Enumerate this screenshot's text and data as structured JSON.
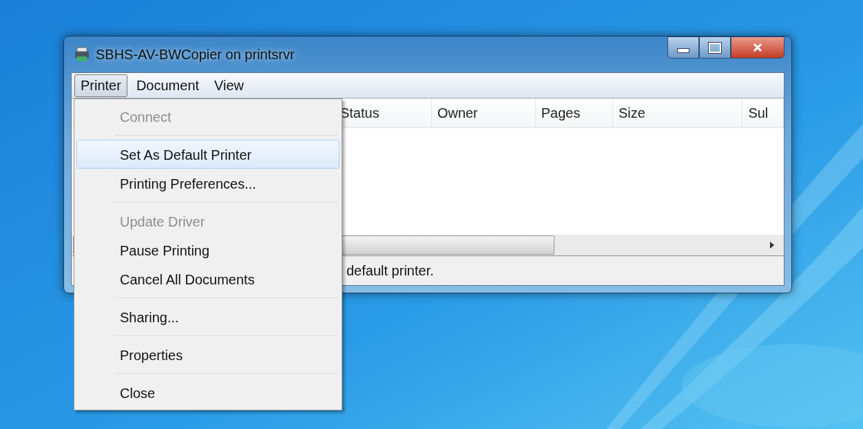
{
  "window": {
    "title": "SBHS-AV-BWCopier on printsrvr"
  },
  "menu_bar": [
    {
      "label": "Printer",
      "selected": true
    },
    {
      "label": "Document",
      "selected": false
    },
    {
      "label": "View",
      "selected": false
    }
  ],
  "table": {
    "columns": [
      "Status",
      "Owner",
      "Pages",
      "Size",
      "Sul"
    ]
  },
  "status_bar": {
    "text": "default printer."
  },
  "printer_menu": [
    {
      "kind": "item",
      "label": "Connect",
      "disabled": true,
      "selected": false
    },
    {
      "kind": "separator"
    },
    {
      "kind": "item",
      "label": "Set As Default Printer",
      "disabled": false,
      "selected": true
    },
    {
      "kind": "item",
      "label": "Printing Preferences...",
      "disabled": false,
      "selected": false
    },
    {
      "kind": "separator"
    },
    {
      "kind": "item",
      "label": "Update Driver",
      "disabled": true,
      "selected": false
    },
    {
      "kind": "item",
      "label": "Pause Printing",
      "disabled": false,
      "selected": false
    },
    {
      "kind": "item",
      "label": "Cancel All Documents",
      "disabled": false,
      "selected": false
    },
    {
      "kind": "separator"
    },
    {
      "kind": "item",
      "label": "Sharing...",
      "disabled": false,
      "selected": false
    },
    {
      "kind": "separator"
    },
    {
      "kind": "item",
      "label": "Properties",
      "disabled": false,
      "selected": false
    },
    {
      "kind": "separator"
    },
    {
      "kind": "item",
      "label": "Close",
      "disabled": false,
      "selected": false
    }
  ]
}
